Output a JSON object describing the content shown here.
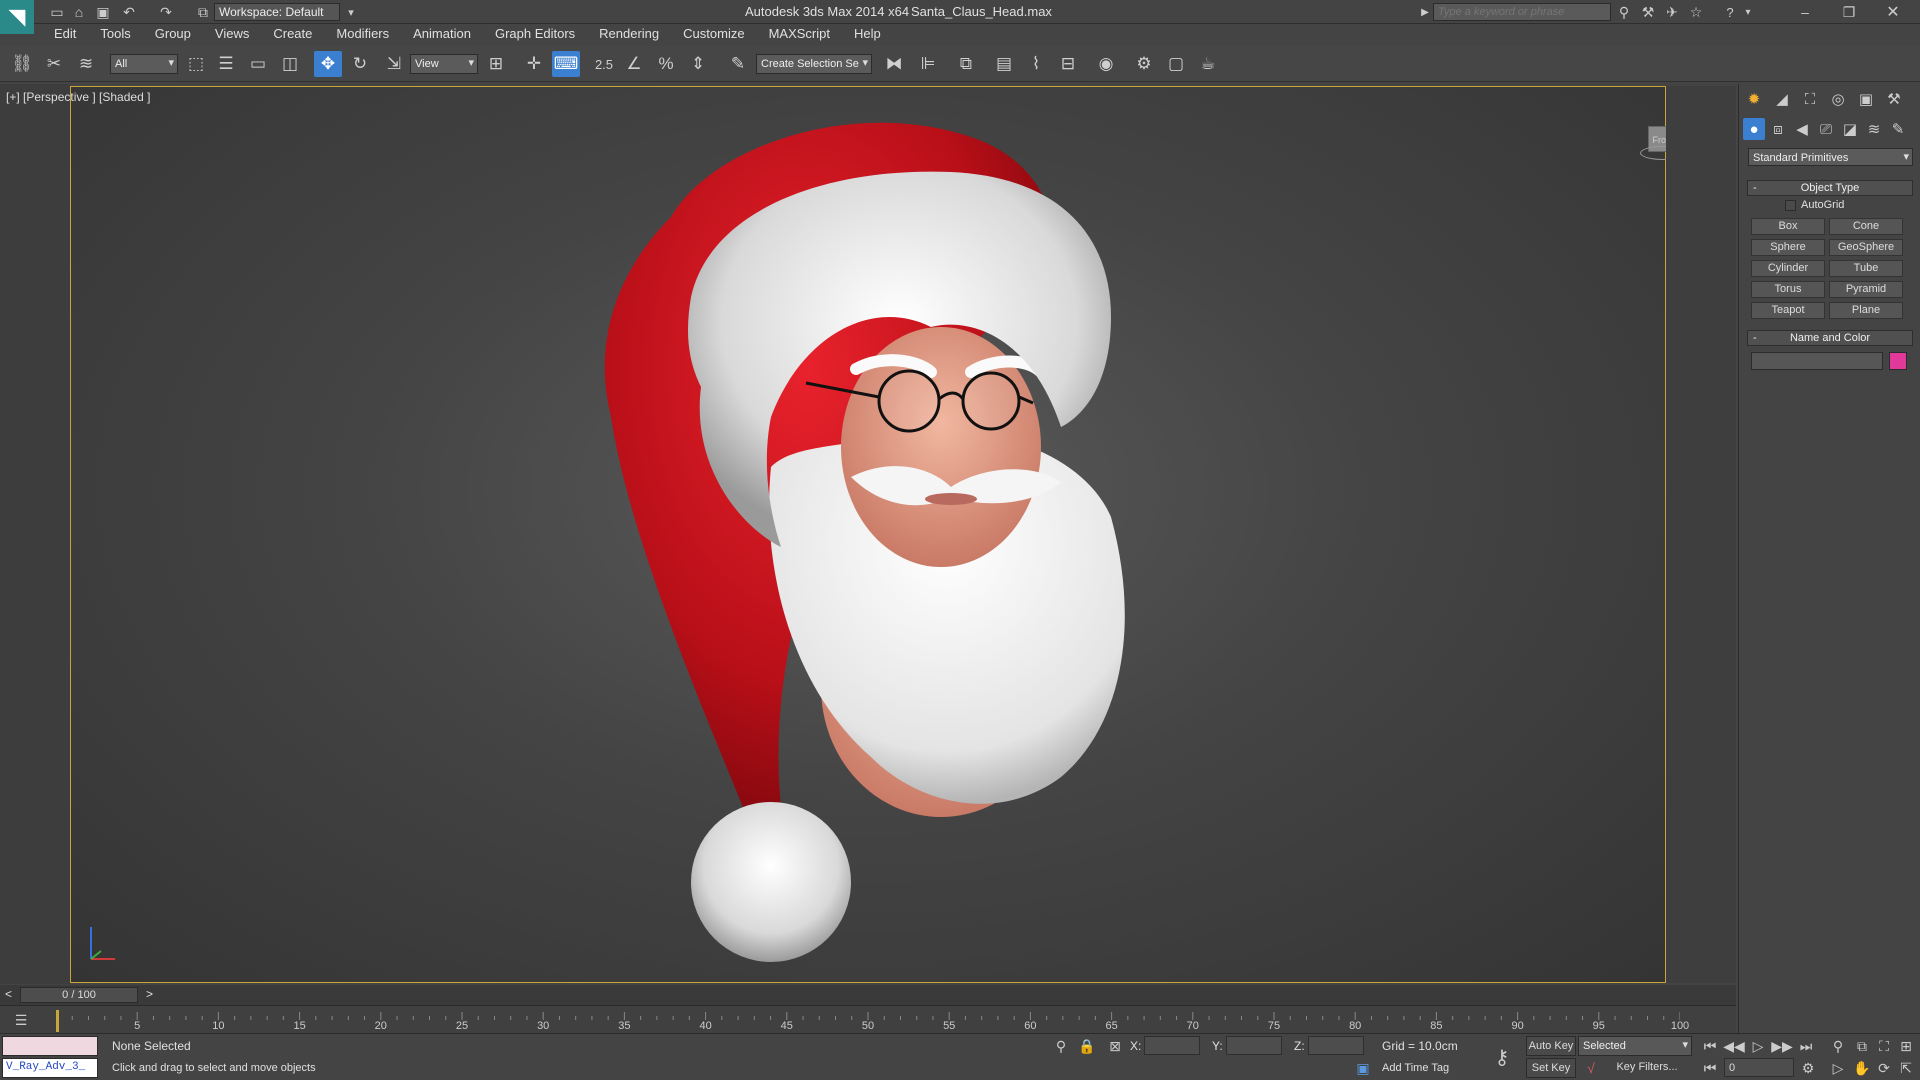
{
  "titlebar": {
    "workspace_label": "Workspace: Default",
    "app_title": "Autodesk 3ds Max  2014 x64",
    "file_name": "Santa_Claus_Head.max",
    "search_placeholder": "Type a keyword or phrase"
  },
  "menu": {
    "items": [
      "Edit",
      "Tools",
      "Group",
      "Views",
      "Create",
      "Modifiers",
      "Animation",
      "Graph Editors",
      "Rendering",
      "Customize",
      "MAXScript",
      "Help"
    ]
  },
  "toolbar": {
    "selection_filter": "All",
    "ref_coord": "View",
    "snap_label": "2.5",
    "selection_set_placeholder": "Create Selection Se"
  },
  "viewport": {
    "label": "[+] [Perspective ] [Shaded ]",
    "viewcube_label": "Front",
    "subject": "Santa Claus head with red hat, white fur trim, glasses and beard"
  },
  "command_panel": {
    "category_dropdown": "Standard Primitives",
    "object_type": {
      "header": "Object Type",
      "autogrid_label": "AutoGrid",
      "autogrid_checked": false,
      "buttons": [
        "Box",
        "Cone",
        "Sphere",
        "GeoSphere",
        "Cylinder",
        "Tube",
        "Torus",
        "Pyramid",
        "Teapot",
        "Plane"
      ]
    },
    "name_and_color": {
      "header": "Name and Color",
      "name_value": "",
      "color": "#e0399a"
    }
  },
  "timeline": {
    "frame_readout": "0 / 100",
    "prev_label": "<",
    "next_label": ">",
    "ticks": [
      "5",
      "10",
      "15",
      "20",
      "25",
      "30",
      "35",
      "40",
      "45",
      "50",
      "55",
      "60",
      "65",
      "70",
      "75",
      "80",
      "85",
      "90",
      "95",
      "100"
    ]
  },
  "status": {
    "maxscript_listener": "V_Ray_Adv_3_",
    "selection_status": "None Selected",
    "prompt": "Click and drag to select and move objects",
    "x_label": "X:",
    "y_label": "Y:",
    "z_label": "Z:",
    "x_value": "",
    "y_value": "",
    "z_value": "",
    "grid": "Grid = 10.0cm",
    "add_time_tag": "Add Time Tag",
    "auto_key": "Auto Key",
    "set_key": "Set Key",
    "key_mode": "Selected",
    "key_filters": "Key Filters...",
    "current_frame": "0"
  },
  "colors": {
    "accent_active": "#3b7fd0",
    "viewport_border": "#c8a63a",
    "hat_red": "#c4121c",
    "fur_white": "#eeeeee",
    "skin": "#e8a58f"
  }
}
